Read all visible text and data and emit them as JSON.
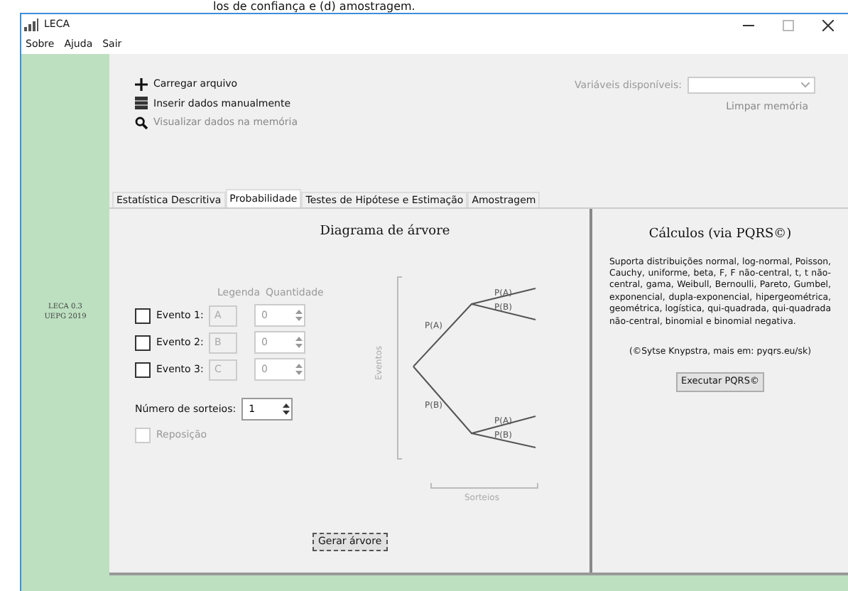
{
  "document_fragment": "los de confiança e (d) amostragem.",
  "window": {
    "title": "LECA"
  },
  "menu": [
    "Sobre",
    "Ajuda",
    "Sair"
  ],
  "sidebar": {
    "version": "LECA 0.3",
    "org": "UEPG 2019"
  },
  "actions": [
    {
      "label": "Carregar arquivo",
      "disabled": false,
      "kind": "plus"
    },
    {
      "label": "Inserir dados manualmente",
      "disabled": false,
      "kind": "table"
    },
    {
      "label": "Visualizar dados na memória",
      "disabled": true,
      "kind": "search"
    }
  ],
  "variables": {
    "label": "Variáveis disponíveis:",
    "clear": "Limpar memória"
  },
  "tabs": [
    {
      "label": "Estatística Descritiva",
      "selected": false
    },
    {
      "label": "Probabilidade",
      "selected": true
    },
    {
      "label": "Testes de Hipótese e Estimação",
      "selected": false
    },
    {
      "label": "Amostragem",
      "selected": false
    }
  ],
  "tree_panel": {
    "title": "Diagrama de árvore",
    "col_legend": "Legenda",
    "col_quantity": "Quantidade",
    "events": [
      {
        "label": "Evento 1:",
        "checked": false,
        "legend": "A",
        "quantity": "0"
      },
      {
        "label": "Evento 2:",
        "checked": false,
        "legend": "B",
        "quantity": "0"
      },
      {
        "label": "Evento 3:",
        "checked": false,
        "legend": "C",
        "quantity": "0"
      }
    ],
    "draws_label": "Número de sorteios:",
    "draws": "1",
    "replacement": {
      "label": "Reposição",
      "checked": false,
      "disabled": true
    },
    "y_axis": "Eventos",
    "x_axis": "Sorteios",
    "branch_labels": [
      "P(A)",
      "P(B)",
      "P(A)",
      "P(B)",
      "P(A)",
      "P(B)"
    ],
    "button": "Gerar árvore"
  },
  "calc_panel": {
    "title": "Cálculos (via PQRS©)",
    "description": "Suporta distribuições normal, log-normal, Poisson, Cauchy, uniforme, beta, F, F não-central, t, t não-central, gama, Weibull, Bernoulli, Pareto, Gumbel, exponencial, dupla-exponencial, hipergeométrica, geométrica, logística, qui-quadrada, qui-quadrada não-central, binomial e binomial negativa.",
    "credit": "(©Sytse Knypstra, mais em: pyqrs.eu/sk)",
    "button": "Executar PQRS©"
  }
}
